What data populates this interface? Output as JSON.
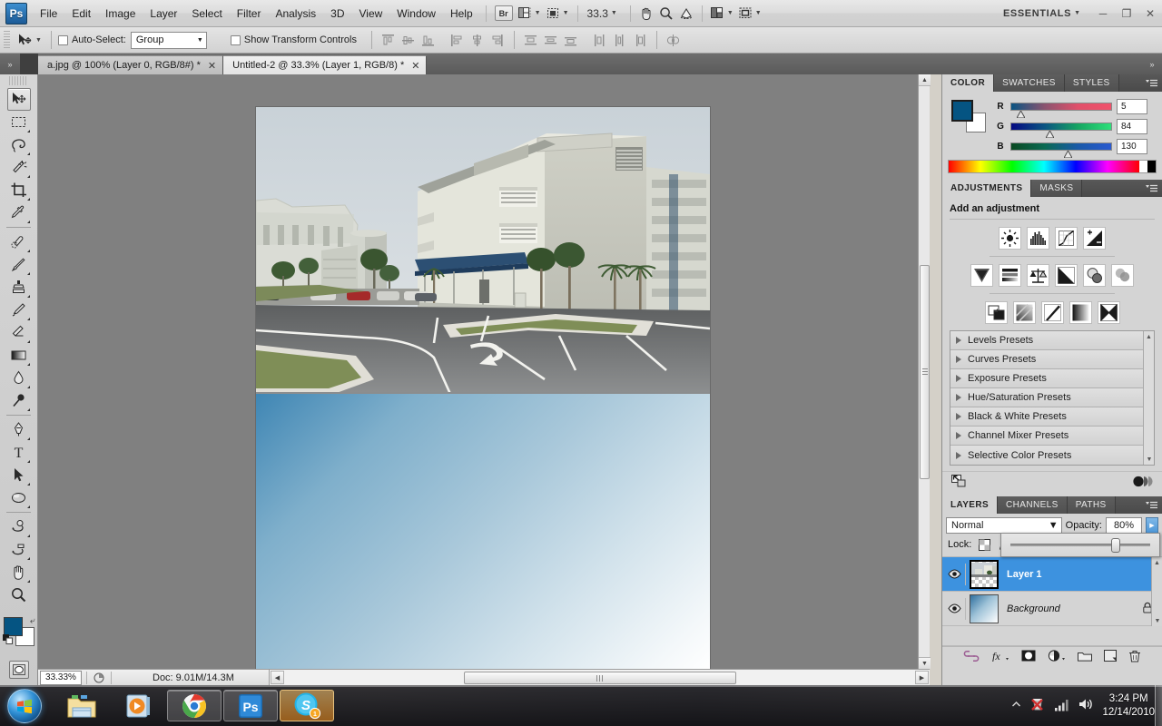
{
  "app": {
    "name": "Adobe Photoshop CS5",
    "logo_text": "Ps",
    "workspace": "ESSENTIALS",
    "zoom_level": "33.3"
  },
  "menubar": {
    "items": [
      "File",
      "Edit",
      "Image",
      "Layer",
      "Select",
      "Filter",
      "Analysis",
      "3D",
      "View",
      "Window",
      "Help"
    ],
    "bridge_label": "Br",
    "window_controls": {
      "minimize": "─",
      "restore": "❐",
      "close": "✕"
    }
  },
  "options_bar": {
    "auto_select_label": "Auto-Select:",
    "auto_select_value": "Group",
    "show_transform_label": "Show Transform Controls"
  },
  "tabs": [
    {
      "title": "a.jpg @ 100% (Layer 0, RGB/8#) *",
      "active": false,
      "close": "✕"
    },
    {
      "title": "Untitled-2 @ 33.3% (Layer 1, RGB/8) *",
      "active": true,
      "close": "✕"
    }
  ],
  "tools": [
    {
      "name": "move-tool",
      "selected": true
    },
    {
      "name": "rectangular-marquee-tool",
      "selected": false
    },
    {
      "name": "lasso-tool",
      "selected": false
    },
    {
      "name": "quick-selection-tool",
      "selected": false
    },
    {
      "name": "crop-tool",
      "selected": false
    },
    {
      "name": "eyedropper-tool",
      "selected": false
    },
    {
      "name": "spot-healing-brush-tool",
      "selected": false
    },
    {
      "name": "brush-tool",
      "selected": false
    },
    {
      "name": "clone-stamp-tool",
      "selected": false
    },
    {
      "name": "history-brush-tool",
      "selected": false
    },
    {
      "name": "eraser-tool",
      "selected": false
    },
    {
      "name": "gradient-tool",
      "selected": false
    },
    {
      "name": "blur-tool",
      "selected": false
    },
    {
      "name": "dodge-tool",
      "selected": false
    },
    {
      "name": "pen-tool",
      "selected": false
    },
    {
      "name": "horizontal-type-tool",
      "selected": false
    },
    {
      "name": "path-selection-tool",
      "selected": false
    },
    {
      "name": "ellipse-shape-tool",
      "selected": false
    },
    {
      "name": "3d-object-rotate-tool",
      "selected": false
    },
    {
      "name": "3d-camera-rotate-tool",
      "selected": false
    },
    {
      "name": "hand-tool",
      "selected": false
    },
    {
      "name": "zoom-tool",
      "selected": false
    }
  ],
  "color_panel": {
    "tabs": [
      "COLOR",
      "SWATCHES",
      "STYLES"
    ],
    "active_tab": "COLOR",
    "foreground_hex": "#055482",
    "background_hex": "#ffffff",
    "channels": [
      {
        "label": "R",
        "value": "5"
      },
      {
        "label": "G",
        "value": "84"
      },
      {
        "label": "B",
        "value": "130"
      }
    ]
  },
  "adjustments_panel": {
    "tabs": [
      "ADJUSTMENTS",
      "MASKS"
    ],
    "active_tab": "ADJUSTMENTS",
    "heading": "Add an adjustment",
    "buttons_row1": [
      "brightness-contrast-icon",
      "levels-icon",
      "curves-icon",
      "exposure-icon"
    ],
    "buttons_row2": [
      "vibrance-icon",
      "hue-saturation-icon",
      "color-balance-icon",
      "black-white-icon",
      "photo-filter-icon",
      "channel-mixer-icon"
    ],
    "buttons_row3": [
      "invert-icon",
      "posterize-icon",
      "threshold-icon",
      "gradient-map-icon",
      "selective-color-icon"
    ],
    "presets": [
      "Levels Presets",
      "Curves Presets",
      "Exposure Presets",
      "Hue/Saturation Presets",
      "Black & White Presets",
      "Channel Mixer Presets",
      "Selective Color Presets"
    ]
  },
  "layers_panel": {
    "tabs": [
      "LAYERS",
      "CHANNELS",
      "PATHS"
    ],
    "active_tab": "LAYERS",
    "blend_mode": "Normal",
    "opacity_label": "Opacity:",
    "opacity_value": "80%",
    "lock_label": "Lock:",
    "layers": [
      {
        "name": "Layer 1",
        "selected": true,
        "visible": true,
        "locked": false,
        "kind": "image"
      },
      {
        "name": "Background",
        "selected": false,
        "visible": true,
        "locked": true,
        "kind": "gradient"
      }
    ],
    "footer_icons": [
      "link-layers-icon",
      "layer-style-icon",
      "layer-mask-icon",
      "new-fill-adjustment-icon",
      "new-group-icon",
      "new-layer-icon",
      "delete-layer-icon"
    ]
  },
  "status_bar": {
    "zoom": "33.33%",
    "doc_info": "Doc: 9.01M/14.3M"
  },
  "canvas": {
    "document_title": "Untitled-2",
    "photo_alt": "campus-building-parking-lot-photo",
    "gradient_from": "#3f86b4",
    "gradient_to": "#ffffff"
  },
  "taskbar": {
    "start_label": "Start",
    "items": [
      {
        "name": "windows-explorer",
        "state": "pinned"
      },
      {
        "name": "windows-media-player",
        "state": "pinned"
      },
      {
        "name": "google-chrome",
        "state": "open"
      },
      {
        "name": "adobe-photoshop",
        "state": "open"
      },
      {
        "name": "skype",
        "state": "active",
        "badge": "1"
      }
    ],
    "tray": [
      "show-hidden-icons",
      "antivirus-alert-icon",
      "network-icon",
      "volume-icon"
    ],
    "time": "3:24 PM",
    "date": "12/14/2010"
  }
}
